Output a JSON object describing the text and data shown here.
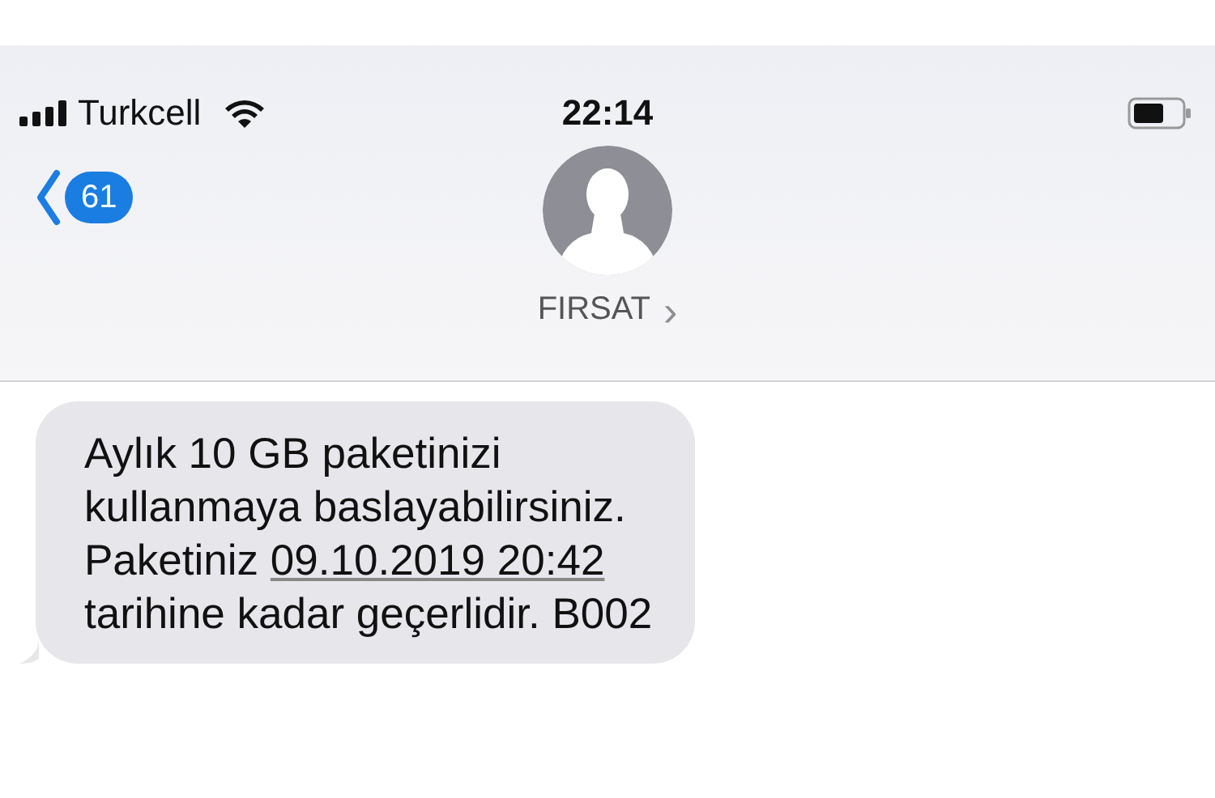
{
  "status_bar": {
    "carrier": "Turkcell",
    "time": "22:14"
  },
  "nav": {
    "back_count": "61",
    "contact": "FIRSAT",
    "chevron": "›"
  },
  "message": {
    "before": "Aylık 10 GB paketinizi\nkullanmaya baslayabilirsiniz.\nPaketiniz ",
    "link": "09.10.2019 20:42",
    "after": "\ntarihine kadar geçerlidir. B002"
  }
}
